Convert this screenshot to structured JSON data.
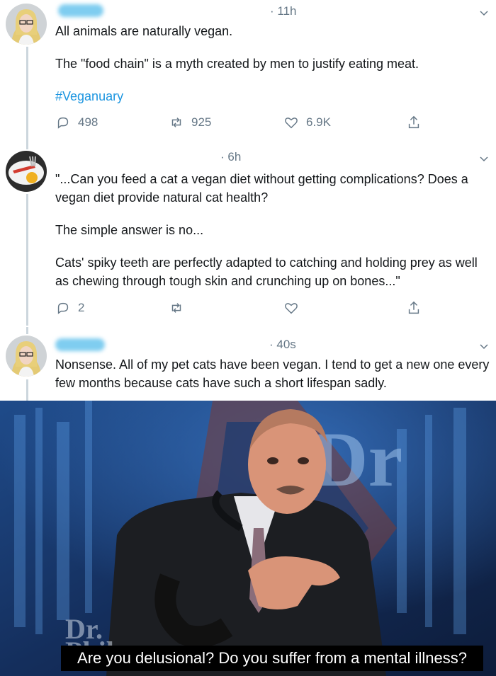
{
  "tweets": [
    {
      "time": "· 11h",
      "lines": [
        "All animals are naturally vegan.",
        "The \"food chain\" is a myth created by men to justify eating meat.",
        "#Veganuary"
      ],
      "replies": "498",
      "retweets": "925",
      "likes": "6.9K",
      "icons": [
        "reply-icon",
        "retweet-icon",
        "like-icon",
        "share-icon"
      ]
    },
    {
      "time": "· 6h",
      "lines": [
        "\"...Can you feed a cat a vegan diet without getting complications? Does a vegan diet provide natural cat health?",
        "The simple answer is no...",
        "Cats' spiky teeth are perfectly adapted to catching and holding prey as well as chewing through tough skin and crunching up on bones...\""
      ],
      "replies": "2",
      "retweets": "",
      "likes": "",
      "icons": [
        "reply-icon",
        "retweet-icon",
        "like-icon",
        "share-icon"
      ]
    },
    {
      "time": "· 40s",
      "lines": [
        "Nonsense. All of my pet cats have been vegan. I tend to get a new one every few months because cats have such a short lifespan sadly."
      ]
    }
  ],
  "meme": {
    "logo_text": "Dr. Phil",
    "watermark_text": "Dr. Phil",
    "caption": "Are you delusional? Do you suffer from a mental illness?"
  },
  "colors": {
    "text": "#14171a",
    "muted": "#657786",
    "link": "#1b95e0",
    "thread_line": "#ccd6dd",
    "caption_bg": "#000000"
  }
}
